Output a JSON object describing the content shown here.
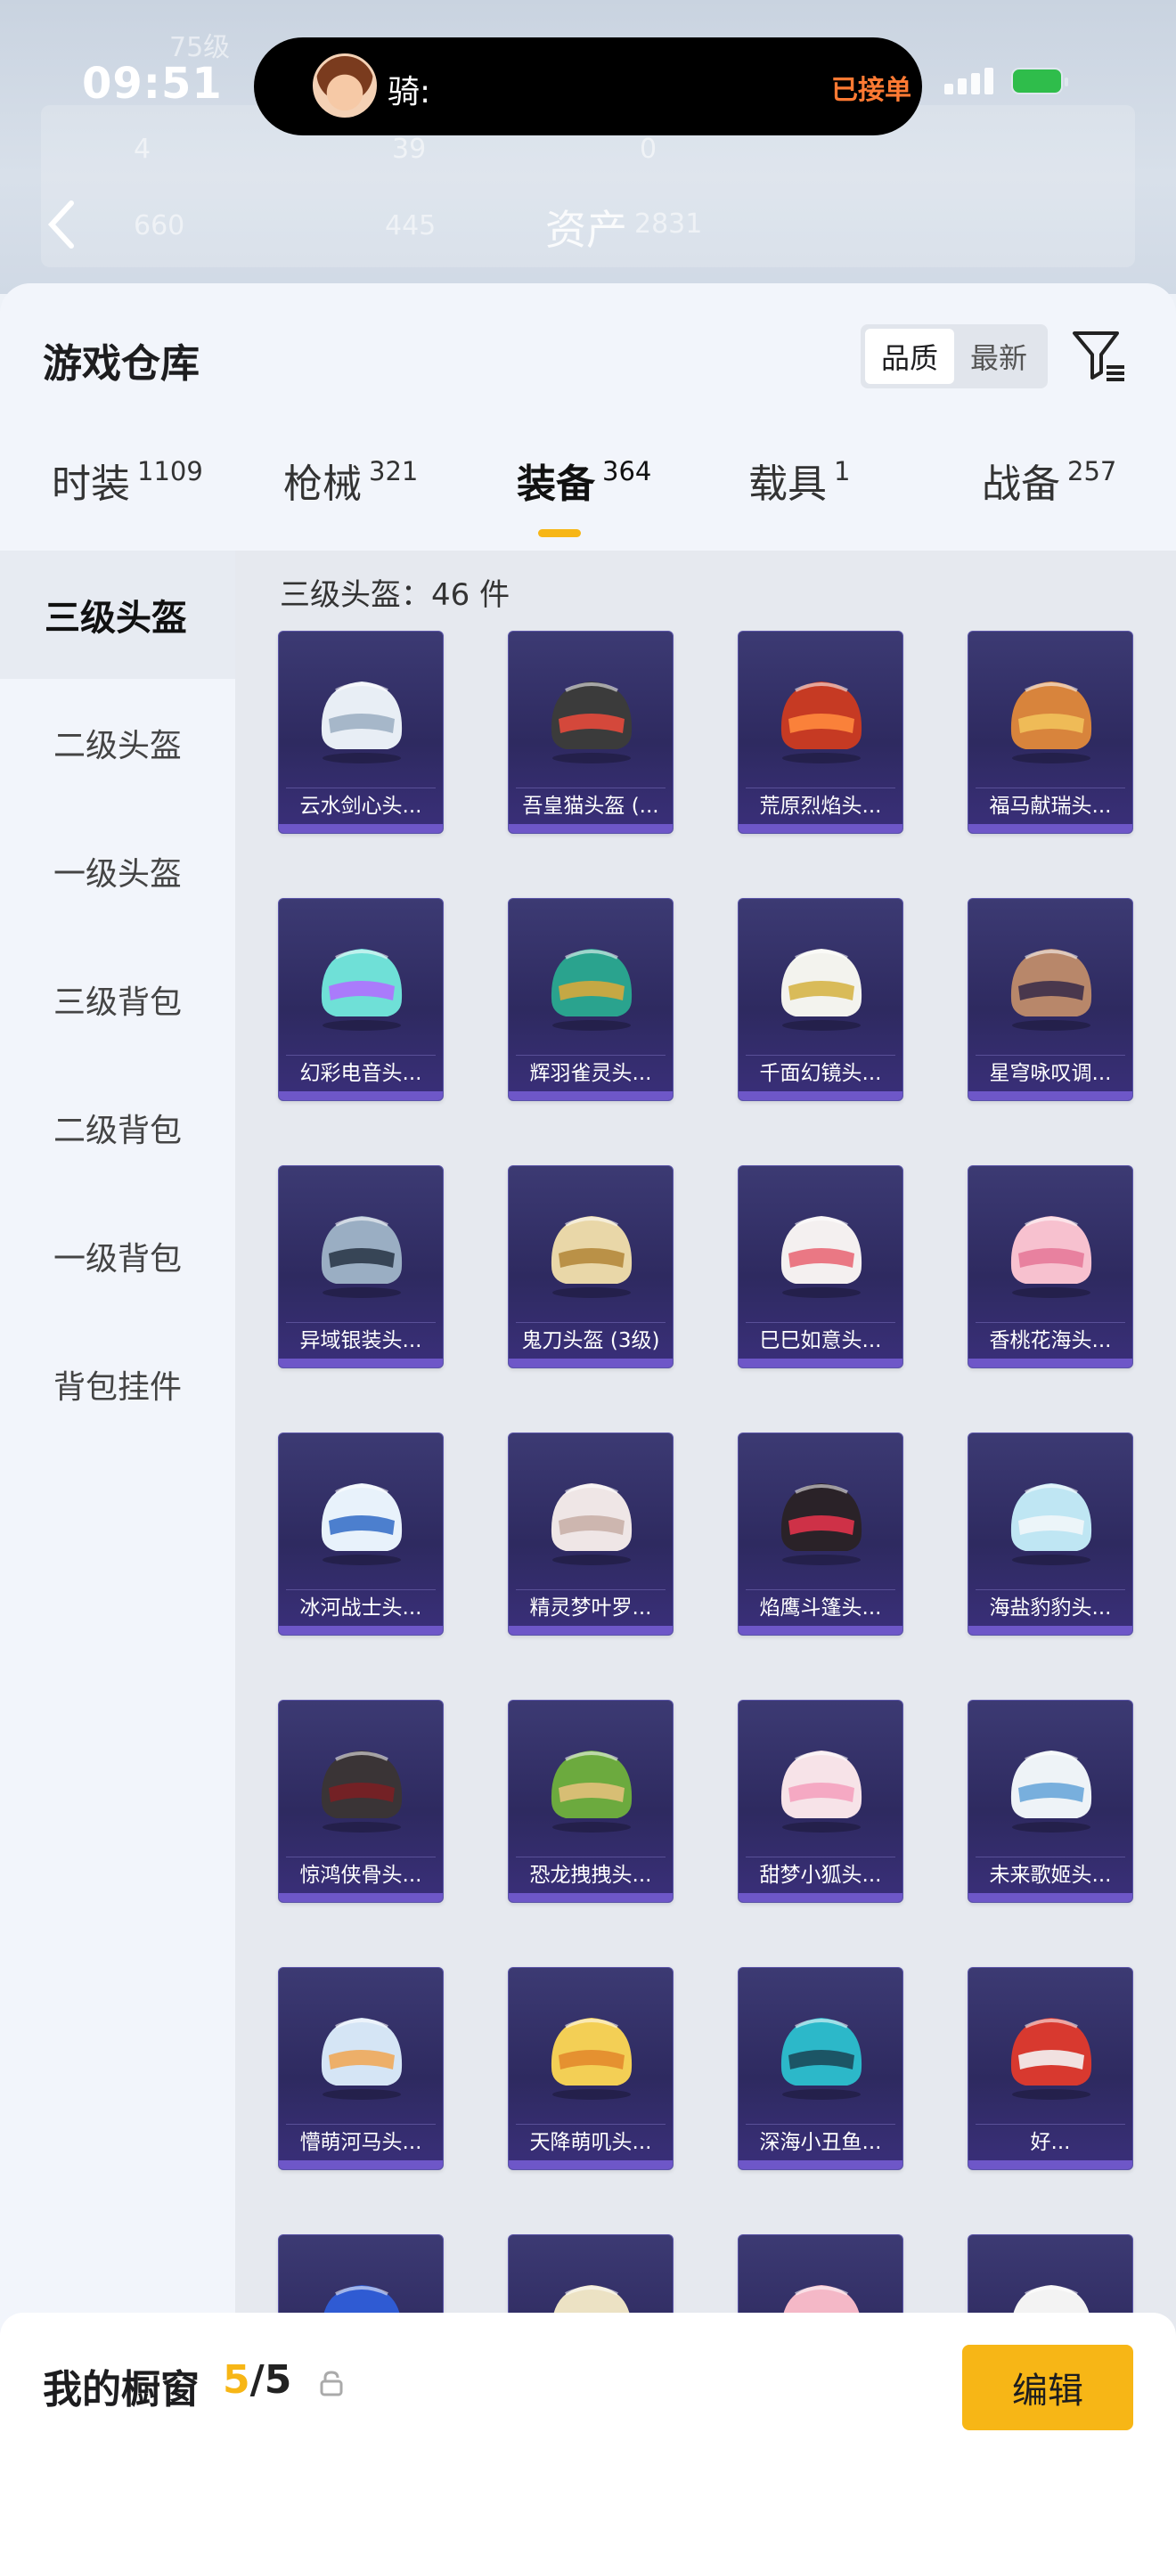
{
  "status_bar": {
    "time": "09:51"
  },
  "island": {
    "name": "骑:",
    "status": "已接单"
  },
  "background": {
    "level": "75级",
    "stats_row1": [
      "4",
      "39",
      "0"
    ],
    "stats_row2": [
      "660",
      "445"
    ],
    "title": "资产",
    "title_value": "2831"
  },
  "header": {
    "title": "游戏仓库",
    "sort_options": [
      "品质",
      "最新"
    ],
    "sort_active": "品质"
  },
  "tabs": [
    {
      "label": "时装",
      "count": "1109"
    },
    {
      "label": "枪械",
      "count": "321"
    },
    {
      "label": "装备",
      "count": "364"
    },
    {
      "label": "载具",
      "count": "1"
    },
    {
      "label": "战备",
      "count": "257"
    }
  ],
  "active_tab": "装备",
  "sidebar": {
    "items": [
      "三级头盔",
      "二级头盔",
      "一级头盔",
      "三级背包",
      "二级背包",
      "一级背包",
      "背包挂件"
    ]
  },
  "content": {
    "section_title": "三级头盔：46 件",
    "items": [
      {
        "name": "云水剑心头...",
        "helmet": "silver"
      },
      {
        "name": "吾皇猫头盔 (...",
        "helmet": "cat"
      },
      {
        "name": "荒原烈焰头...",
        "helmet": "flame"
      },
      {
        "name": "福马献瑞头...",
        "helmet": "horse"
      },
      {
        "name": "幻彩电音头...",
        "helmet": "cyber"
      },
      {
        "name": "辉羽雀灵头...",
        "helmet": "bird"
      },
      {
        "name": "千面幻镜头...",
        "helmet": "mirror"
      },
      {
        "name": "星穹咏叹调...",
        "helmet": "mask"
      },
      {
        "name": "异域银装头...",
        "helmet": "steel"
      },
      {
        "name": "鬼刀头盔 (3级)",
        "helmet": "gold"
      },
      {
        "name": "巳巳如意头...",
        "helmet": "white"
      },
      {
        "name": "香桃花海头...",
        "helmet": "pink"
      },
      {
        "name": "冰河战士头...",
        "helmet": "ice"
      },
      {
        "name": "精灵梦叶罗...",
        "helmet": "wing"
      },
      {
        "name": "焰鹰斗篷头...",
        "helmet": "redhawk"
      },
      {
        "name": "海盐豹豹头...",
        "helmet": "seal"
      },
      {
        "name": "惊鸿侠骨头...",
        "helmet": "dark"
      },
      {
        "name": "恐龙拽拽头...",
        "helmet": "frog"
      },
      {
        "name": "甜梦小狐头...",
        "helmet": "fox"
      },
      {
        "name": "未来歌姬头...",
        "helmet": "singer"
      },
      {
        "name": "懵萌河马头...",
        "helmet": "hippo"
      },
      {
        "name": "天降萌叽头...",
        "helmet": "yellow"
      },
      {
        "name": "深海小丑鱼...",
        "helmet": "teal"
      },
      {
        "name": "好...",
        "helmet": "red"
      },
      {
        "name": "",
        "helmet": "blue"
      },
      {
        "name": "",
        "helmet": "cream"
      },
      {
        "name": "",
        "helmet": "pinkround"
      },
      {
        "name": "",
        "helmet": "redwhite"
      }
    ]
  },
  "bottom": {
    "showcase_label": "我的橱窗",
    "showcase_current": "5",
    "showcase_total": "/5",
    "edit_label": "编辑"
  },
  "colors": {
    "accent": "#f7b616",
    "card_bg": "#2e2a60",
    "orange_status": "#ff7a33"
  }
}
